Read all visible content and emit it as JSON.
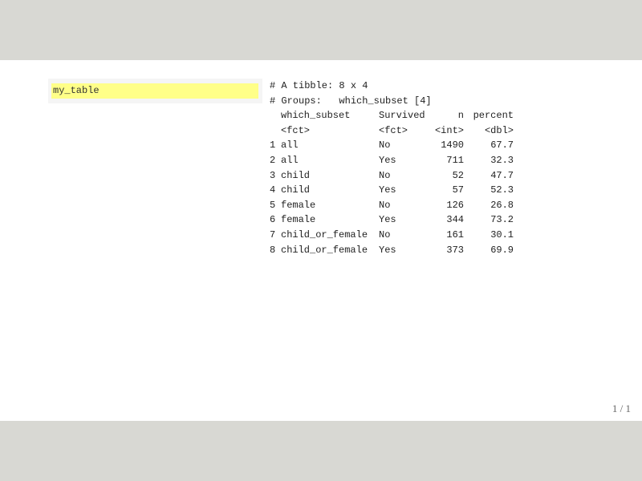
{
  "code": {
    "text": "my_table"
  },
  "output": {
    "header_line1": "# A tibble: 8 x 4",
    "header_line2": "# Groups:   which_subset [4]",
    "columns": [
      "which_subset",
      "Survived",
      "n",
      "percent"
    ],
    "types": [
      "<fct>",
      "<fct>",
      "<int>",
      "<dbl>"
    ],
    "rows": [
      {
        "idx": "1",
        "which_subset": "all",
        "survived": "No",
        "n": "1490",
        "percent": "67.7"
      },
      {
        "idx": "2",
        "which_subset": "all",
        "survived": "Yes",
        "n": "711",
        "percent": "32.3"
      },
      {
        "idx": "3",
        "which_subset": "child",
        "survived": "No",
        "n": "52",
        "percent": "47.7"
      },
      {
        "idx": "4",
        "which_subset": "child",
        "survived": "Yes",
        "n": "57",
        "percent": "52.3"
      },
      {
        "idx": "5",
        "which_subset": "female",
        "survived": "No",
        "n": "126",
        "percent": "26.8"
      },
      {
        "idx": "6",
        "which_subset": "female",
        "survived": "Yes",
        "n": "344",
        "percent": "73.2"
      },
      {
        "idx": "7",
        "which_subset": "child_or_female",
        "survived": "No",
        "n": "161",
        "percent": "30.1"
      },
      {
        "idx": "8",
        "which_subset": "child_or_female",
        "survived": "Yes",
        "n": "373",
        "percent": "69.9"
      }
    ]
  },
  "page_number": "1 / 1",
  "colors": {
    "highlight": "#ffff88",
    "background": "#d8d8d3"
  }
}
